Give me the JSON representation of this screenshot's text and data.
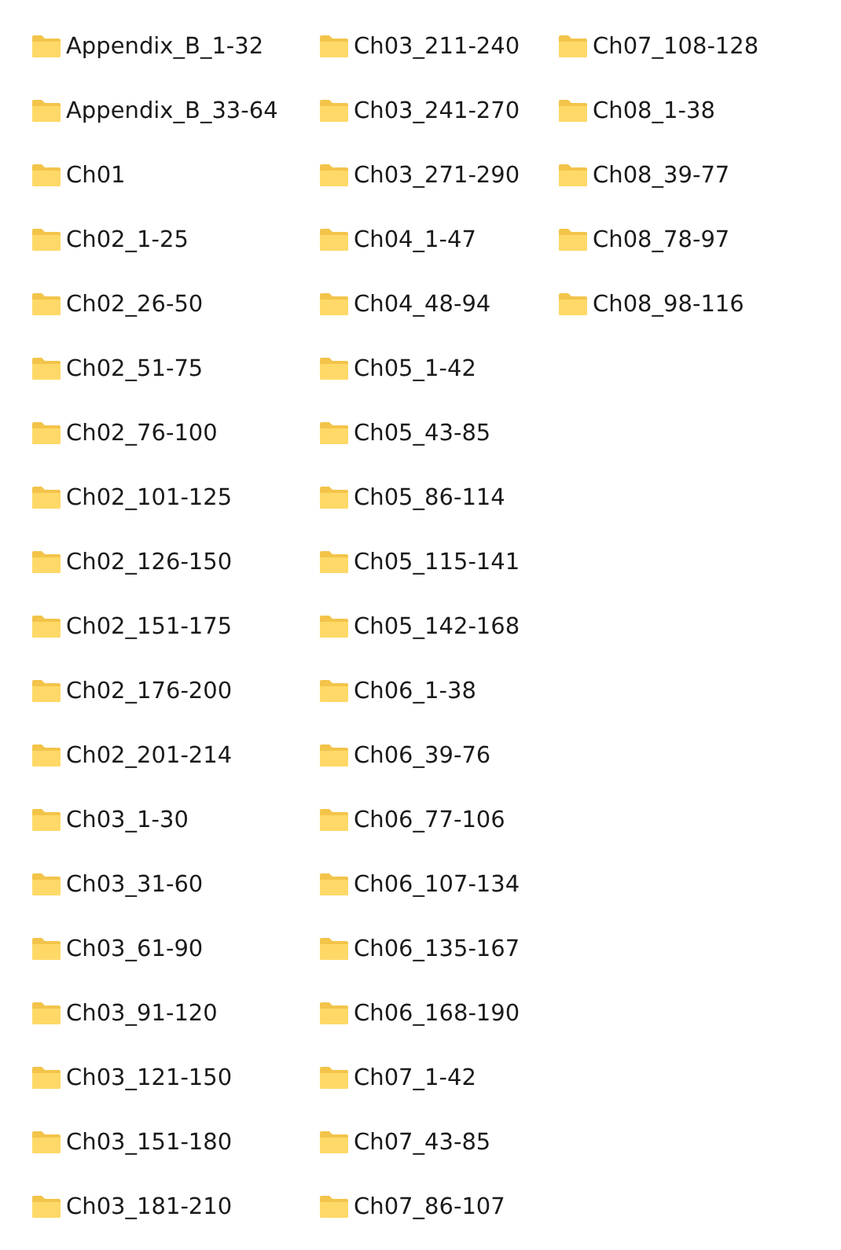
{
  "folders": [
    {
      "name": "Appendix_B_1-32"
    },
    {
      "name": "Appendix_B_33-64"
    },
    {
      "name": "Ch01"
    },
    {
      "name": "Ch02_1-25"
    },
    {
      "name": "Ch02_26-50"
    },
    {
      "name": "Ch02_51-75"
    },
    {
      "name": "Ch02_76-100"
    },
    {
      "name": "Ch02_101-125"
    },
    {
      "name": "Ch02_126-150"
    },
    {
      "name": "Ch02_151-175"
    },
    {
      "name": "Ch02_176-200"
    },
    {
      "name": "Ch02_201-214"
    },
    {
      "name": "Ch03_1-30"
    },
    {
      "name": "Ch03_31-60"
    },
    {
      "name": "Ch03_61-90"
    },
    {
      "name": "Ch03_91-120"
    },
    {
      "name": "Ch03_121-150"
    },
    {
      "name": "Ch03_151-180"
    },
    {
      "name": "Ch03_181-210"
    },
    {
      "name": "Ch03_211-240"
    },
    {
      "name": "Ch03_241-270"
    },
    {
      "name": "Ch03_271-290"
    },
    {
      "name": "Ch04_1-47"
    },
    {
      "name": "Ch04_48-94"
    },
    {
      "name": "Ch05_1-42"
    },
    {
      "name": "Ch05_43-85"
    },
    {
      "name": "Ch05_86-114"
    },
    {
      "name": "Ch05_115-141"
    },
    {
      "name": "Ch05_142-168"
    },
    {
      "name": "Ch06_1-38"
    },
    {
      "name": "Ch06_39-76"
    },
    {
      "name": "Ch06_77-106"
    },
    {
      "name": "Ch06_107-134"
    },
    {
      "name": "Ch06_135-167"
    },
    {
      "name": "Ch06_168-190"
    },
    {
      "name": "Ch07_1-42"
    },
    {
      "name": "Ch07_43-85"
    },
    {
      "name": "Ch07_86-107"
    },
    {
      "name": "Ch07_108-128"
    },
    {
      "name": "Ch08_1-38"
    },
    {
      "name": "Ch08_39-77"
    },
    {
      "name": "Ch08_78-97"
    },
    {
      "name": "Ch08_98-116"
    }
  ]
}
